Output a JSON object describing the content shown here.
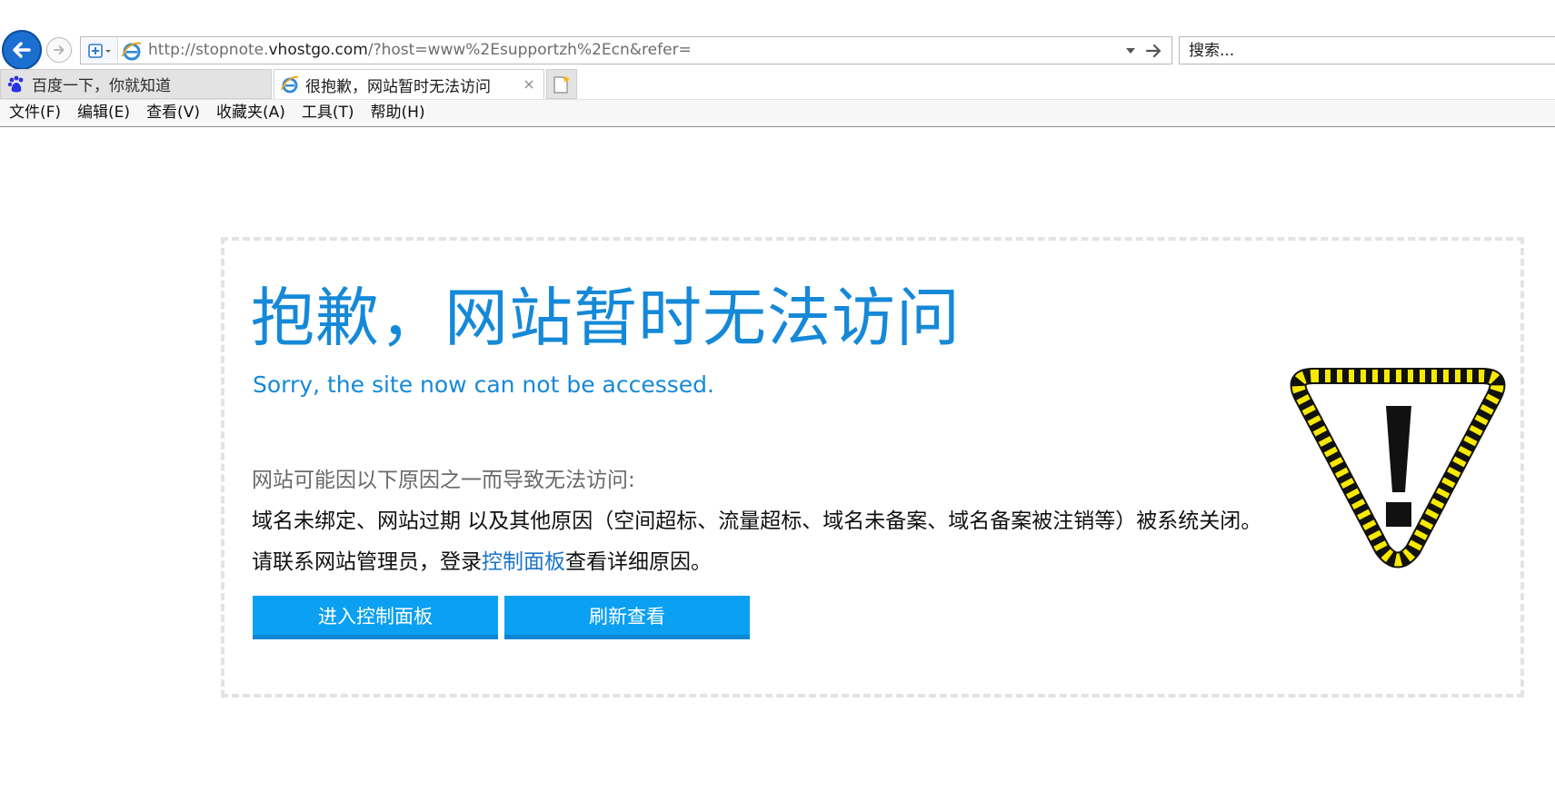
{
  "browser": {
    "address_bar": {
      "url_prefix": "http://stopnote.",
      "url_host": "vhostgo.com",
      "url_suffix": "/?host=www%2Esupportzh%2Ecn&refer="
    },
    "search": {
      "placeholder": "搜索..."
    },
    "tabs": [
      {
        "label": "百度一下，你就知道",
        "icon": "baidu-paw-icon",
        "active": false
      },
      {
        "label": "很抱歉，网站暂时无法访问",
        "icon": "ie-icon",
        "active": true,
        "close_glyph": "×"
      }
    ],
    "menu": [
      {
        "label": "文件(F)"
      },
      {
        "label": "编辑(E)"
      },
      {
        "label": "查看(V)"
      },
      {
        "label": "收藏夹(A)"
      },
      {
        "label": "工具(T)"
      },
      {
        "label": "帮助(H)"
      }
    ]
  },
  "page": {
    "title_cn": "抱歉，网站暂时无法访问",
    "title_en": "Sorry, the site now can not be accessed.",
    "reason_intro": "网站可能因以下原因之一而导致无法访问:",
    "reason_line": "域名未绑定、网站过期 以及其他原因（空间超标、流量超标、域名未备案、域名备案被注销等）被系统关闭。",
    "contact_prefix": "请联系网站管理员，登录",
    "contact_link": "控制面板",
    "contact_suffix": "查看详细原因。",
    "buttons": {
      "panel": "进入控制面板",
      "refresh": "刷新查看"
    },
    "colors": {
      "title": "#1589d8",
      "button": "#0ba0f2",
      "link": "#1a74c6",
      "warning_stripe_a": "#f7ea00",
      "warning_stripe_b": "#111111"
    },
    "warning_icon": "caution-triangle-icon"
  }
}
